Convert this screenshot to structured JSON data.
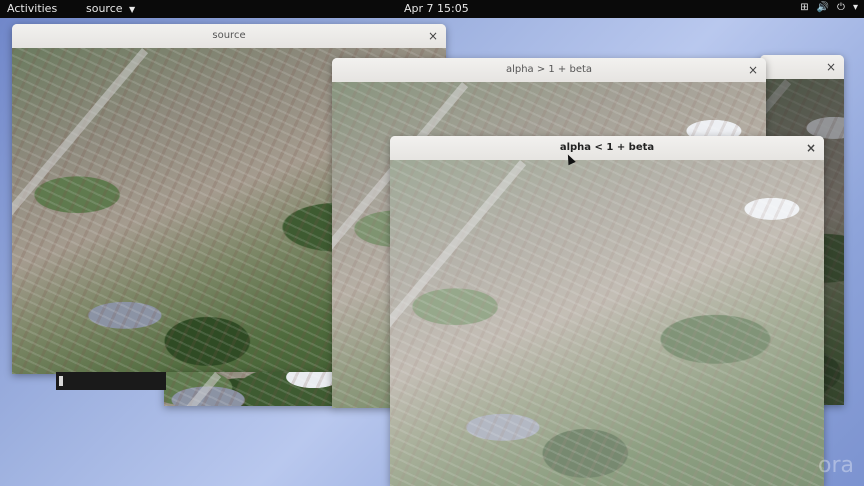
{
  "topbar": {
    "activities": "Activities",
    "app_menu": "source",
    "clock": "Apr 7  15:05",
    "tray_icons": [
      "network-icon",
      "volume-icon",
      "power-icon",
      "chevron-down-icon"
    ]
  },
  "windows": {
    "source": {
      "title": "source",
      "close": "×"
    },
    "beta_gt": {
      "title": "alpha > 1 + beta",
      "close": "×"
    },
    "beta_lt": {
      "title": "alpha < 1 + beta",
      "close": "×"
    },
    "rear": {
      "title": "",
      "close": "×"
    }
  },
  "terminal": {
    "text": ""
  },
  "desktop": {
    "watermark": "ora"
  }
}
